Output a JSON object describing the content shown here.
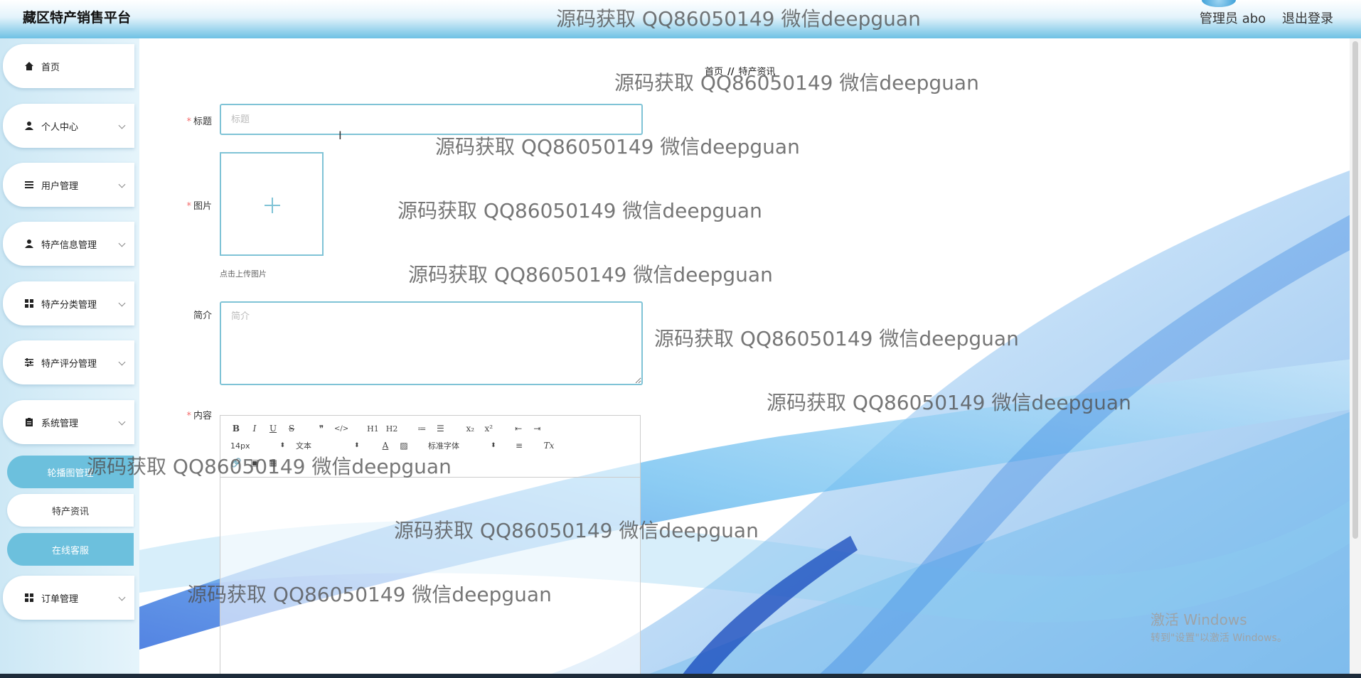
{
  "header": {
    "app_title": "藏区特产销售平台",
    "admin_label": "管理员 abo",
    "logout_label": "退出登录"
  },
  "sidebar": {
    "items": [
      {
        "label": "首页",
        "icon": "home-icon"
      },
      {
        "label": "个人中心",
        "icon": "user-icon"
      },
      {
        "label": "用户管理",
        "icon": "list-icon"
      },
      {
        "label": "特产信息管理",
        "icon": "user-icon"
      },
      {
        "label": "特产分类管理",
        "icon": "grid-icon"
      },
      {
        "label": "特产评分管理",
        "icon": "sliders-icon"
      },
      {
        "label": "系统管理",
        "icon": "clipboard-icon"
      },
      {
        "label": "订单管理",
        "icon": "grid-icon"
      }
    ],
    "sub_items": [
      {
        "label": "轮播图管理"
      },
      {
        "label": "特产资讯"
      },
      {
        "label": "在线客服"
      }
    ]
  },
  "breadcrumb": {
    "home": "首页",
    "separator": "//",
    "current": "特产资讯"
  },
  "form": {
    "title_label": "标题",
    "title_placeholder": "标题",
    "image_label": "图片",
    "upload_hint": "点击上传图片",
    "summary_label": "简介",
    "summary_placeholder": "简介",
    "content_label": "内容"
  },
  "editor": {
    "row1": [
      "B",
      "I",
      "U",
      "S",
      "❞",
      "</>",
      "H1",
      "H2",
      "≔",
      "☰",
      "x₂",
      "x²",
      "⇤",
      "⇥"
    ],
    "font_size": "14px",
    "text_style": "文本",
    "font_family": "标准字体",
    "row2_icons": [
      "A",
      "▨",
      "≡",
      "Tx"
    ],
    "row3_icons": [
      "🔗",
      "▣",
      "▦"
    ]
  },
  "watermark_text": "源码获取 QQ86050149 微信deepguan",
  "os_overlay": {
    "line1": "激活 Windows",
    "line2": "转到\"设置\"以激活 Windows。"
  }
}
